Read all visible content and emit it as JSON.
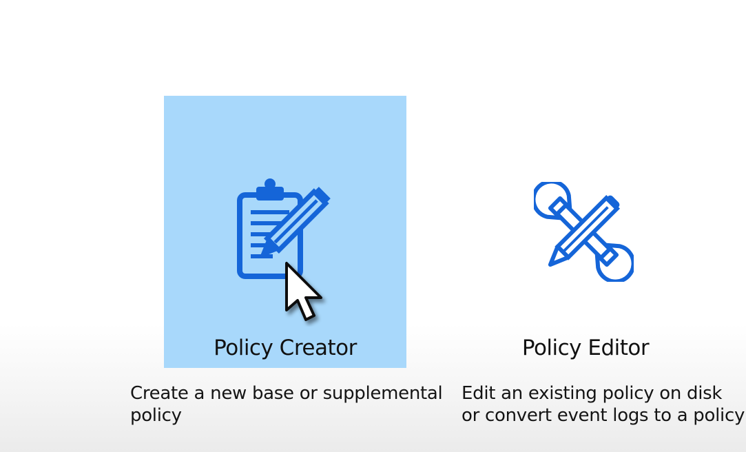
{
  "tiles": {
    "creator": {
      "label": "Policy Creator",
      "description": "Create a new base or supplemental policy",
      "icon": "clipboard-pencil-icon",
      "selected": true
    },
    "editor": {
      "label": "Policy Editor",
      "description": "Edit an existing policy on disk or convert event logs to a policy",
      "icon": "pencil-wrench-icon",
      "selected": false
    }
  },
  "colors": {
    "selected_tile_bg": "#a8d8fb",
    "icon_blue": "#1565d8",
    "text": "#111111"
  }
}
